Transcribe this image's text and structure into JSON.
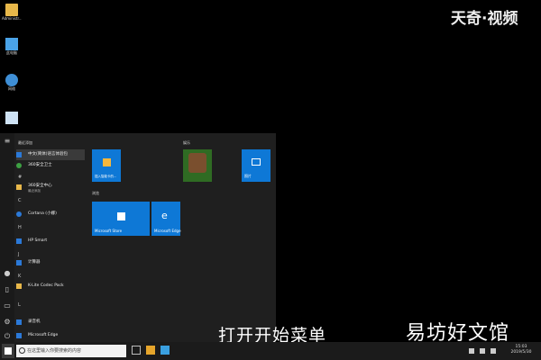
{
  "watermark": "天奇·视频",
  "desktop": {
    "icons": [
      {
        "label": "Administr...",
        "icon": "user-folder-icon"
      },
      {
        "label": "此电脑",
        "icon": "computer-icon"
      },
      {
        "label": "网络",
        "icon": "network-icon"
      },
      {
        "label": "",
        "icon": "recycle-bin-icon"
      }
    ]
  },
  "start_menu": {
    "recent_header": "最近添加",
    "apps": [
      {
        "label": "中文(简体)语言体验包",
        "icon": "language-pack-icon"
      },
      {
        "label": "360安全卫士",
        "icon": "security-icon"
      },
      {
        "label": "#",
        "is_letter": true
      },
      {
        "label": "360安全中心",
        "sub": "最近添加",
        "icon": "folder-icon"
      },
      {
        "label": "C",
        "is_letter": true
      },
      {
        "label": "Cortana (小娜)",
        "icon": "cortana-icon"
      },
      {
        "label": "H",
        "is_letter": true
      },
      {
        "label": "HP Smart",
        "icon": "hp-icon"
      },
      {
        "label": "J",
        "is_letter": true
      },
      {
        "label": "计算器",
        "icon": "calculator-icon"
      },
      {
        "label": "K",
        "is_letter": true
      },
      {
        "label": "K-Lite Codec Pack",
        "icon": "folder-icon"
      },
      {
        "label": "L",
        "is_letter": true
      },
      {
        "label": "录音机",
        "icon": "recorder-icon"
      },
      {
        "label": "Microsoft Edge",
        "icon": "edge-icon"
      }
    ],
    "tiles": {
      "group1_header": "",
      "group2_header": "浏览",
      "group3_header": "娱乐",
      "tile_items": [
        {
          "label": "插入智能卡的...",
          "icon": "gift-icon"
        },
        {
          "label": "Microsoft Store",
          "icon": "store-icon"
        },
        {
          "label": "Microsoft Edge",
          "icon": "edge-icon"
        },
        {
          "label": "",
          "icon": "xbox-game-icon"
        },
        {
          "label": "照片",
          "icon": "photos-icon"
        }
      ]
    }
  },
  "caption": "打开开始菜单",
  "brand": "易坊好文馆",
  "taskbar": {
    "search_placeholder": "在这里输入你要搜索的内容",
    "clock_time": "15:03",
    "clock_date": "2019/5/30"
  }
}
